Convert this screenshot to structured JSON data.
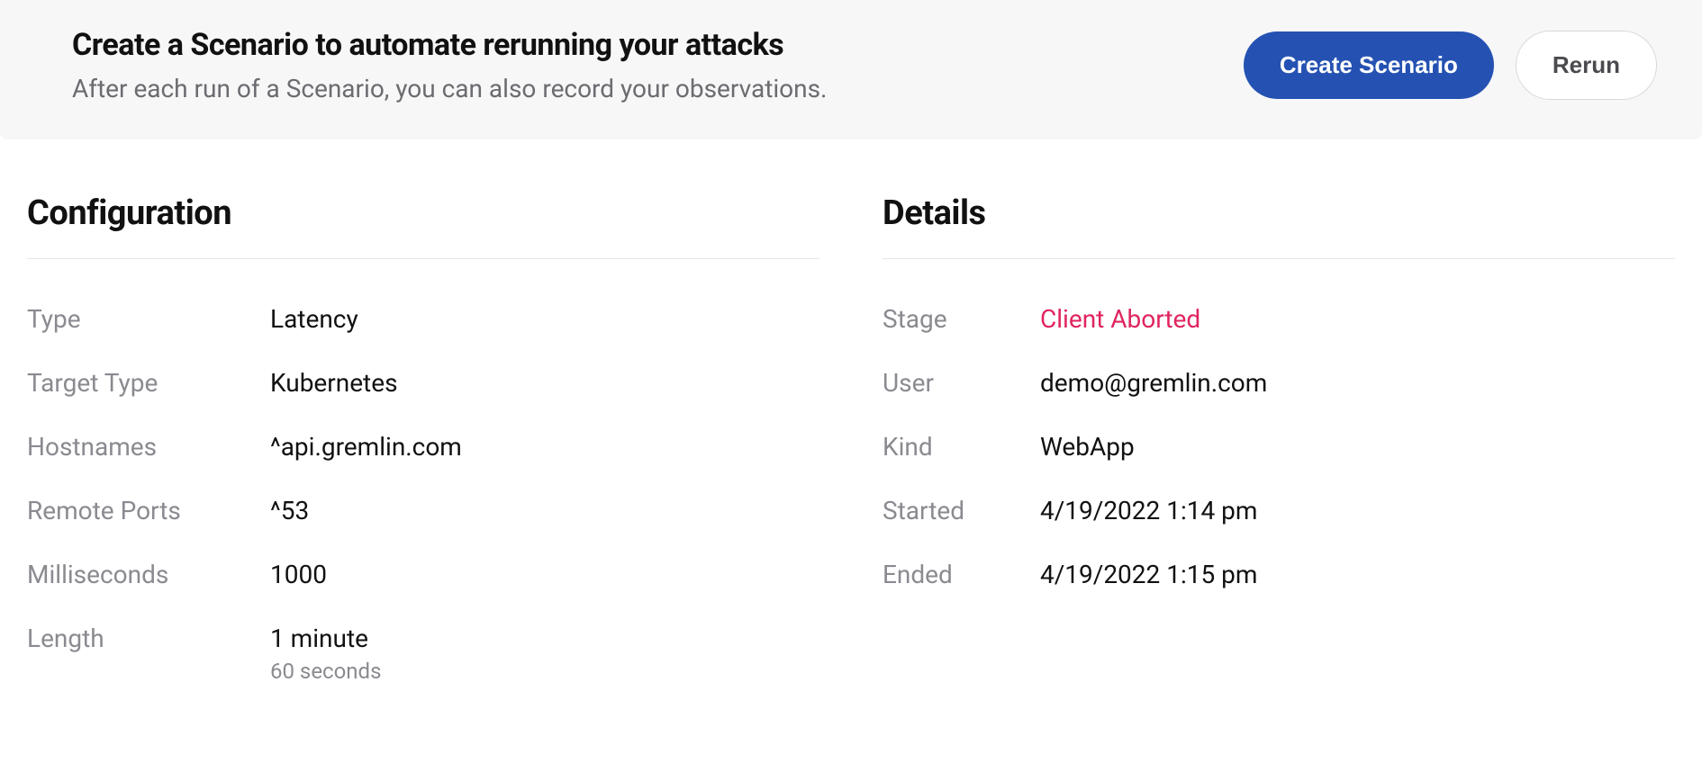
{
  "banner": {
    "title": "Create a Scenario to automate rerunning your attacks",
    "subtitle": "After each run of a Scenario, you can also record your observations.",
    "create_label": "Create Scenario",
    "rerun_label": "Rerun"
  },
  "configuration": {
    "heading": "Configuration",
    "rows": {
      "type_label": "Type",
      "type_value": "Latency",
      "target_type_label": "Target Type",
      "target_type_value": "Kubernetes",
      "hostnames_label": "Hostnames",
      "hostnames_value": "^api.gremlin.com",
      "remote_ports_label": "Remote Ports",
      "remote_ports_value": "^53",
      "milliseconds_label": "Milliseconds",
      "milliseconds_value": "1000",
      "length_label": "Length",
      "length_value": "1 minute",
      "length_sub": "60 seconds"
    }
  },
  "details": {
    "heading": "Details",
    "rows": {
      "stage_label": "Stage",
      "stage_value": "Client Aborted",
      "user_label": "User",
      "user_value": "demo@gremlin.com",
      "kind_label": "Kind",
      "kind_value": "WebApp",
      "started_label": "Started",
      "started_value": "4/19/2022 1:14 pm",
      "ended_label": "Ended",
      "ended_value": "4/19/2022 1:15 pm"
    }
  }
}
